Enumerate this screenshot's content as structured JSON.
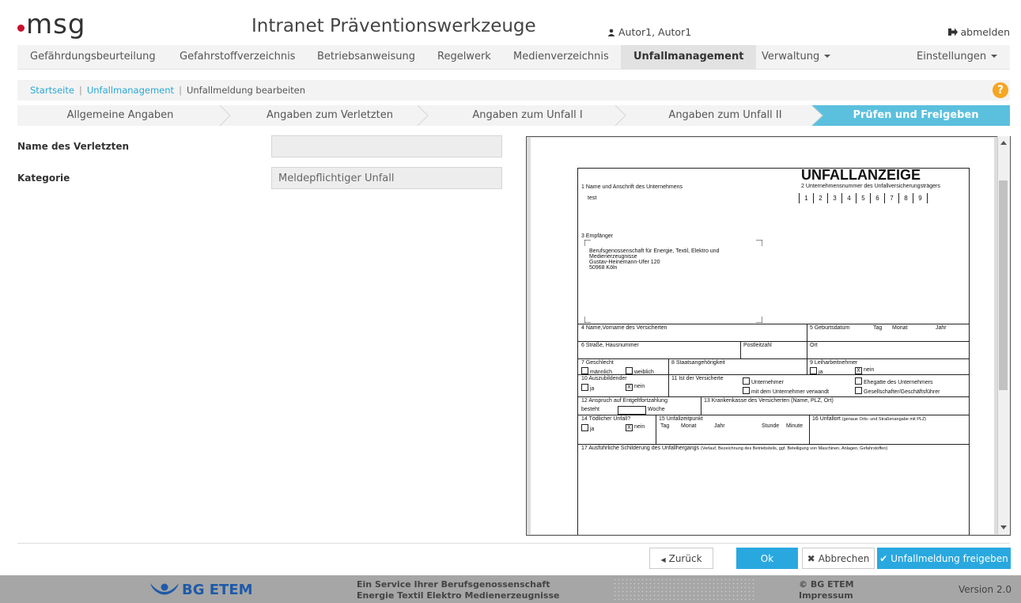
{
  "header": {
    "logo": "msg",
    "title": "Intranet Präventionswerkzeuge",
    "user": "Autor1, Autor1",
    "logout": "abmelden"
  },
  "nav": {
    "items": [
      "Gefährdungsbeurteilung",
      "Gefahrstoffverzeichnis",
      "Betriebsanweisung",
      "Regelwerk",
      "Medienverzeichnis",
      "Unfallmanagement",
      "Verwaltung",
      "Einstellungen"
    ],
    "active": "Unfallmanagement"
  },
  "breadcrumb": {
    "home": "Startseite",
    "section": "Unfallmanagement",
    "current": "Unfallmeldung bearbeiten"
  },
  "wizard": {
    "steps": [
      "Allgemeine Angaben",
      "Angaben zum Verletzten",
      "Angaben zum Unfall I",
      "Angaben zum Unfall II",
      "Prüfen und Freigeben"
    ],
    "active_index": 4
  },
  "form": {
    "name_label": "Name des Verletzten",
    "name_value": "",
    "category_label": "Kategorie",
    "category_value": "Meldepflichtiger Unfall"
  },
  "document": {
    "title": "UNFALLANZEIGE",
    "f1": "1 Name und Anschrift des Unternehmens",
    "f1_value": "test",
    "f2": "2 Unternehmensnummer des Unfallversicherungsträgers",
    "digits": [
      "1",
      "2",
      "3",
      "4",
      "5",
      "6",
      "7",
      "8",
      "9"
    ],
    "f3": "3 Empfänger",
    "recipient_1": "Berufsgenossenschaft für Energie, Textil, Elektro und",
    "recipient_2": "Medienerzeugnisse",
    "recipient_3": "Gustav-Heinemann-Ufer 120",
    "recipient_4": "50968 Köln",
    "f4": "4 Name,Vorname des Versicherten",
    "f5": "5 Geburtsdatum",
    "tag": "Tag",
    "monat": "Monat",
    "jahr": "Jahr",
    "f6": "6 Straße, Hausnummer",
    "postleitzahl": "Postleitzahl",
    "ort": "Ort",
    "f7": "7 Geschlecht",
    "maennlich": "männlich",
    "weiblich": "weiblich",
    "f8": "8 Staatsangehörigkeit",
    "f9": "9 Leiharbeitnehmer",
    "ja": "ja",
    "nein": "nein",
    "x": "X",
    "f10": "10 Auszubildender",
    "f11": "11 Ist der Versicherte",
    "unternehmer": "Unternehmer",
    "verwandt": "mit dem Unternehmer verwandt",
    "ehegatte": "Ehegatte des Unternehmers",
    "gesellschafter": "Gesellschafter/Geschäftsführer",
    "f12": "12 Anspruch auf Entgeltfortzahlung",
    "besteht": "besteht",
    "woche": "Woche",
    "f13": "13 Krankenkasse des Versicherten (Name, PLZ, Ort)",
    "f14": "14 Tödlicher Unfall?",
    "f15": "15 Unfallzeitpunkt",
    "stunde": "Stunde",
    "minute": "Minute",
    "f16": "16 Unfallort",
    "f16_hint": "(genaue Orts- und Straßenangabe mit PLZ)",
    "f17": "17 Ausführliche Schilderung des Unfallhergangs",
    "f17_hint": "(Verlauf, Bezeichnung des Betriebsteils, ggf. Beteiligung von Maschinen, Anlagen, Gefahrstoffen)"
  },
  "buttons": {
    "back": "Zurück",
    "ok": "Ok",
    "cancel": "Abbrechen",
    "release": "Unfallmeldung freigeben"
  },
  "footer": {
    "brand": "BG ETEM",
    "service_1": "Ein Service Ihrer Berufsgenossenschaft",
    "service_2": "Energie Textil Elektro Medienerzeugnisse",
    "copyright": "© BG ETEM",
    "impressum": "Impressum",
    "version": "Version 2.0"
  },
  "colors": {
    "accent": "#29a8e0",
    "wizard_active": "#5bc0de",
    "logo_dot": "#c8102e",
    "help": "#f5a623",
    "footer": "#a6a6a6"
  }
}
